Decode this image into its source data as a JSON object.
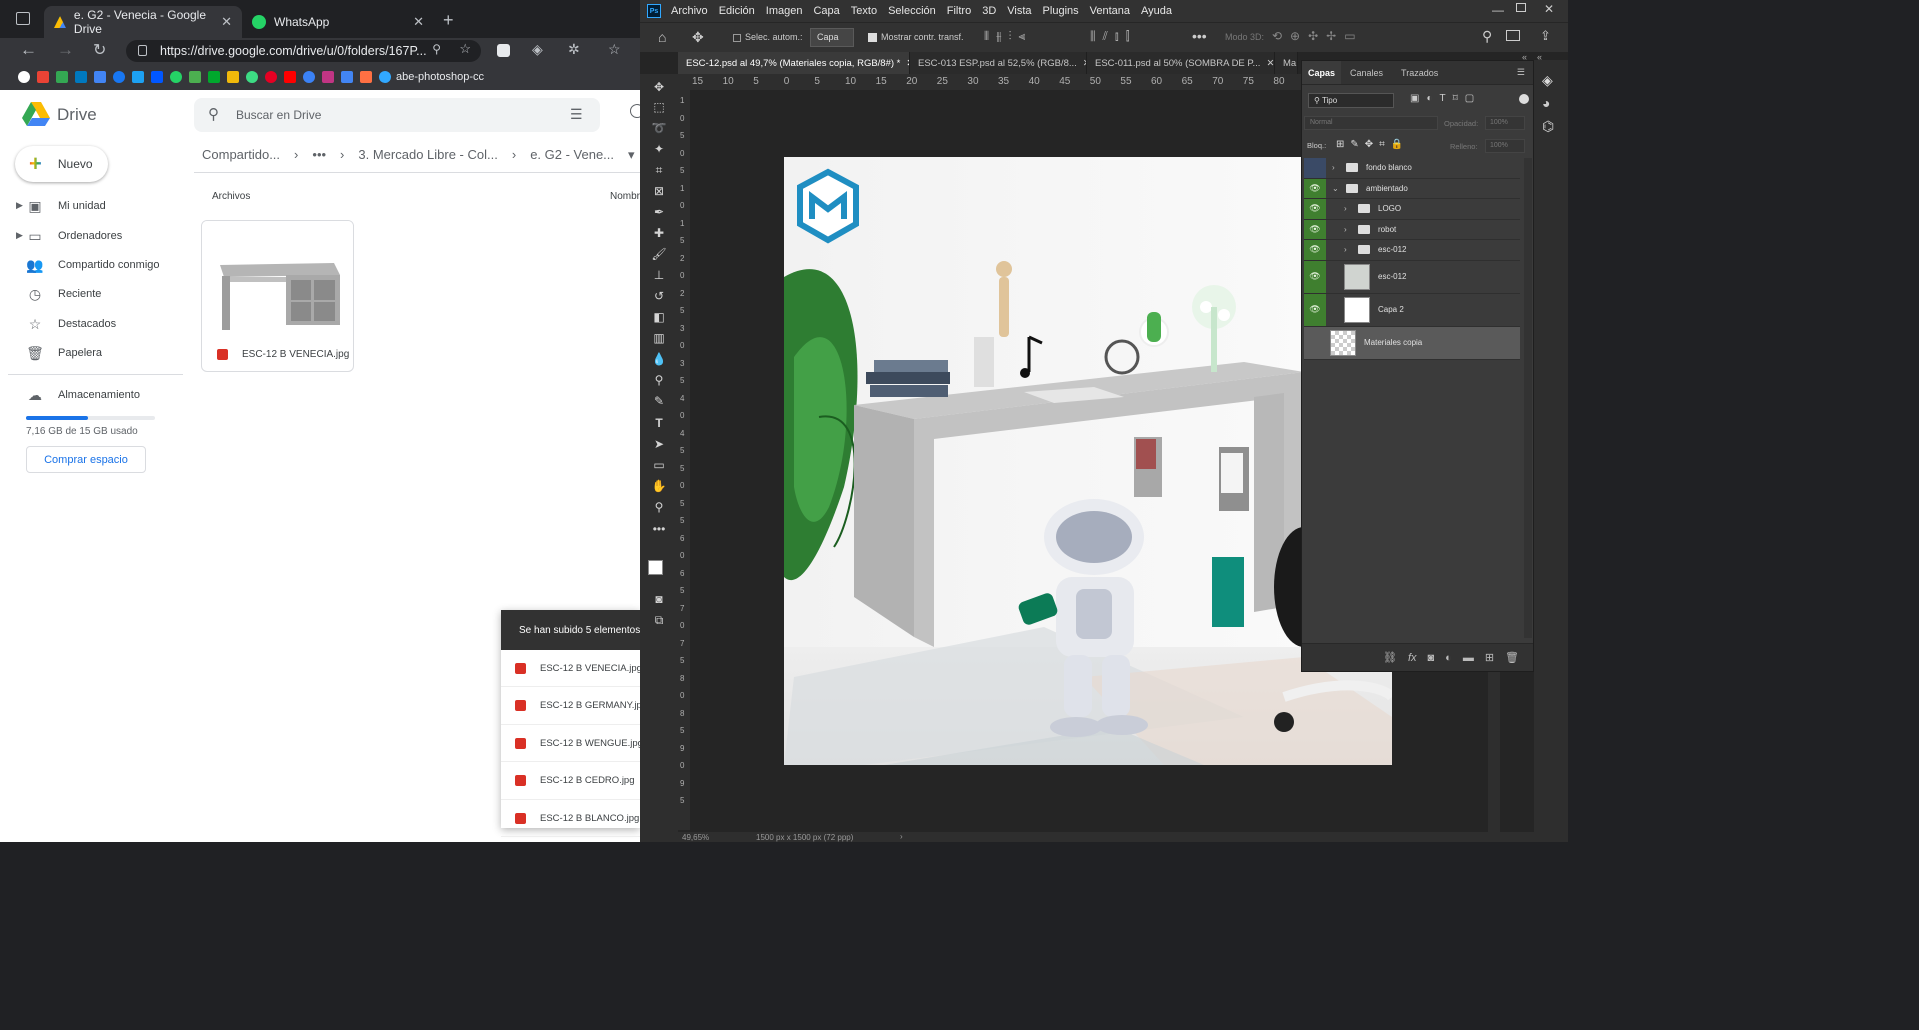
{
  "browser": {
    "tabs": [
      {
        "title": "e. G2 - Venecia - Google Drive",
        "icon": "drive-icon"
      },
      {
        "title": "WhatsApp",
        "icon": "whatsapp-icon"
      }
    ],
    "url": "https://drive.google.com/drive/u/0/folders/167P...",
    "bookmark_label": "abe-photoshop-cc"
  },
  "drive": {
    "logo_text": "Drive",
    "search_placeholder": "Buscar en Drive",
    "new_button": "Nuevo",
    "breadcrumb": [
      "Compartido...",
      "•••",
      "3. Mercado Libre - Col...",
      "e. G2 - Vene..."
    ],
    "sidebar": [
      {
        "label": "Mi unidad",
        "icon": "drive-folder-icon"
      },
      {
        "label": "Ordenadores",
        "icon": "computer-icon"
      },
      {
        "label": "Compartido conmigo",
        "icon": "shared-icon"
      },
      {
        "label": "Reciente",
        "icon": "clock-icon"
      },
      {
        "label": "Destacados",
        "icon": "star-icon"
      },
      {
        "label": "Papelera",
        "icon": "trash-icon"
      }
    ],
    "storage_label": "Almacenamiento",
    "storage_used": "7,16 GB de 15 GB usado",
    "storage_fraction": 0.477,
    "buy_button": "Comprar espacio",
    "section_label": "Archivos",
    "sort_label": "Nombr",
    "file_name": "ESC-12 B VENECIA.jpg",
    "upload_title": "Se han subido 5 elementos",
    "uploads": [
      "ESC-12 B VENECIA.jpg",
      "ESC-12 B GERMANY.jpg",
      "ESC-12 B WENGUE.jpg",
      "ESC-12 B CEDRO.jpg",
      "ESC-12 B BLANCO.jpg"
    ]
  },
  "photoshop": {
    "menu": [
      "Archivo",
      "Edición",
      "Imagen",
      "Capa",
      "Texto",
      "Selección",
      "Filtro",
      "3D",
      "Vista",
      "Plugins",
      "Ventana",
      "Ayuda"
    ],
    "options": {
      "auto_select": "Selec. autom.:",
      "auto_select_value": "Capa",
      "show_transform": "Mostrar contr. transf.",
      "mode_3d": "Modo 3D:"
    },
    "doc_tabs": [
      "ESC-12.psd al 49,7% (Materiales copia, RGB/8#) *",
      "ESC-013 ESP.psd al 52,5% (RGB/8...",
      "ESC-011.psd al 50% (SOMBRA DE P...",
      "Ma"
    ],
    "ruler_labels": [
      "15",
      "10",
      "5",
      "0",
      "5",
      "10",
      "15",
      "20",
      "25",
      "30",
      "35",
      "40",
      "45",
      "50",
      "55",
      "60",
      "65",
      "70",
      "75",
      "80"
    ],
    "vruler_digits": [
      "1",
      "0",
      "5",
      "0",
      "5",
      "1",
      "0",
      "1",
      "5",
      "2",
      "0",
      "2",
      "5",
      "3",
      "0",
      "3",
      "5",
      "4",
      "0",
      "4",
      "5",
      "5",
      "0",
      "5",
      "5",
      "6",
      "0",
      "6",
      "5",
      "7",
      "0",
      "7",
      "5",
      "8",
      "0",
      "8",
      "5",
      "9",
      "0",
      "9",
      "5"
    ],
    "status_zoom": "49,65%",
    "status_size": "1500 px x 1500 px (72 ppp)",
    "panel_tabs": [
      "Capas",
      "Canales",
      "Trazados"
    ],
    "filter_kind": "Tipo",
    "blend_mode": "Normal",
    "opacity_label": "Opacidad:",
    "opacity_value": "100%",
    "lock_label": "Bloq.:",
    "fill_label": "Relleno:",
    "fill_value": "100%",
    "layers": [
      {
        "name": "fondo blanco",
        "kind": "group",
        "visible": false
      },
      {
        "name": "ambientado",
        "kind": "group",
        "visible": true
      },
      {
        "name": "LOGO",
        "kind": "group",
        "visible": true
      },
      {
        "name": "robot",
        "kind": "group",
        "visible": true
      },
      {
        "name": "esc-012",
        "kind": "group",
        "visible": true
      },
      {
        "name": "esc-012",
        "kind": "image",
        "visible": true
      },
      {
        "name": "Capa 2",
        "kind": "fill",
        "visible": true
      },
      {
        "name": "Materiales copia",
        "kind": "smart",
        "visible": false,
        "selected": true
      }
    ],
    "colors": {
      "panel": "#3b3b3b",
      "selected_layer": "#5a5a5a",
      "eye_bg": "#3f7f2f"
    }
  }
}
